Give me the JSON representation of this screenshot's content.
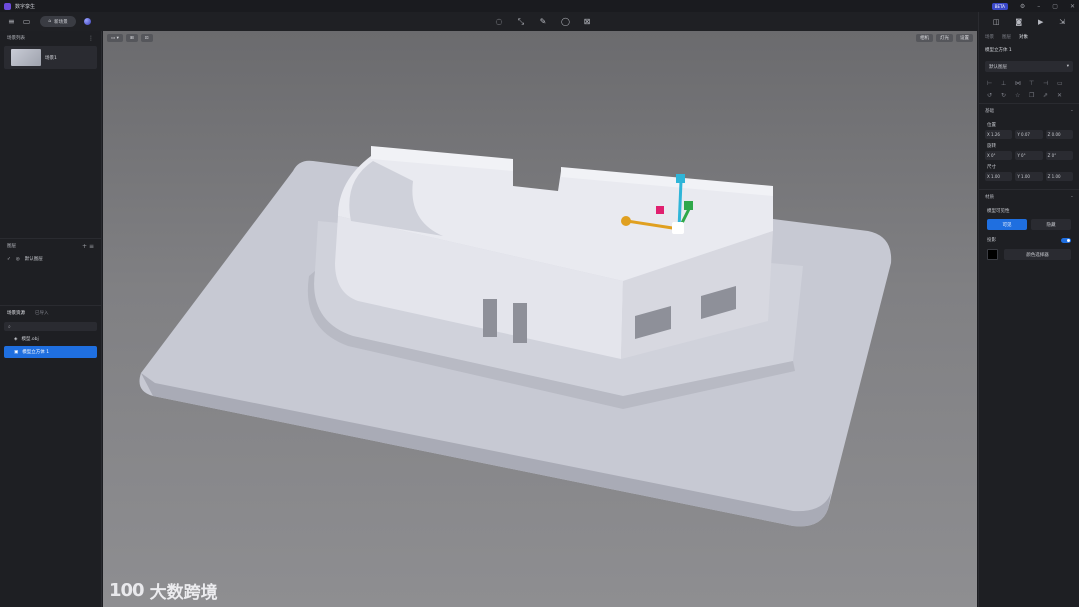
{
  "app": {
    "title": "数字孪生"
  },
  "window": {
    "beta": "BETA"
  },
  "toolbar": {
    "center_pill": "新场景"
  },
  "left": {
    "scene_list_title": "场景列表",
    "scene_name": "场景1",
    "layers_title": "图层",
    "layer_default": "默认图层",
    "tabs": [
      "场景资源",
      "已导入"
    ],
    "tree": [
      "模型.obj",
      "模型立方体 1"
    ]
  },
  "viewport": {
    "right_btns": [
      "相机",
      "灯光",
      "设置"
    ],
    "watermark_logo": "100",
    "watermark_text": "大数跨境"
  },
  "right": {
    "tabs": [
      "场景",
      "图层",
      "对象"
    ],
    "title": "模型立方体 1",
    "select": "默认图层",
    "section_basic": "基础",
    "position": "位置",
    "pos": [
      "X 1.26",
      "Y 0.07",
      "Z 0.00"
    ],
    "rotation": "旋转",
    "rot": [
      "X 0°",
      "Y 0°",
      "Z 0°"
    ],
    "size": "尺寸",
    "sz": [
      "X 1.00",
      "Y 1.00",
      "Z 1.00"
    ],
    "section_material": "材质",
    "material_label": "模型可见性",
    "btn_on": "可见",
    "btn_off": "隐藏",
    "shadow": "投影",
    "color_btn": "颜色选择器"
  }
}
